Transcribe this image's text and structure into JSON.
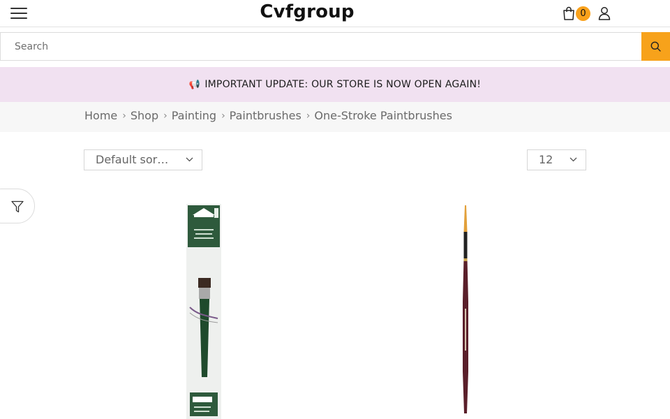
{
  "header": {
    "logo": "Cvfgroup",
    "cart_count": "0"
  },
  "search": {
    "placeholder": "Search"
  },
  "notice": {
    "icon": "📢",
    "text": "IMPORTANT UPDATE: OUR STORE IS NOW OPEN AGAIN!"
  },
  "breadcrumb": {
    "items": [
      "Home",
      "Shop",
      "Painting",
      "Paintbrushes",
      "One-Stroke Paintbrushes"
    ],
    "separator": "›"
  },
  "toolbar": {
    "sort_selected": "Default sor…",
    "per_page_selected": "12"
  },
  "icons": {
    "menu": "hamburger-icon",
    "cart": "shopping-bag-icon",
    "account": "user-icon",
    "search": "search-icon",
    "filter": "filter-icon",
    "chevron": "chevron-down-icon"
  },
  "colors": {
    "accent": "#f7a21b",
    "notice_bg": "#f1e1f1",
    "breadcrumb_bg": "#f7f7f7"
  }
}
